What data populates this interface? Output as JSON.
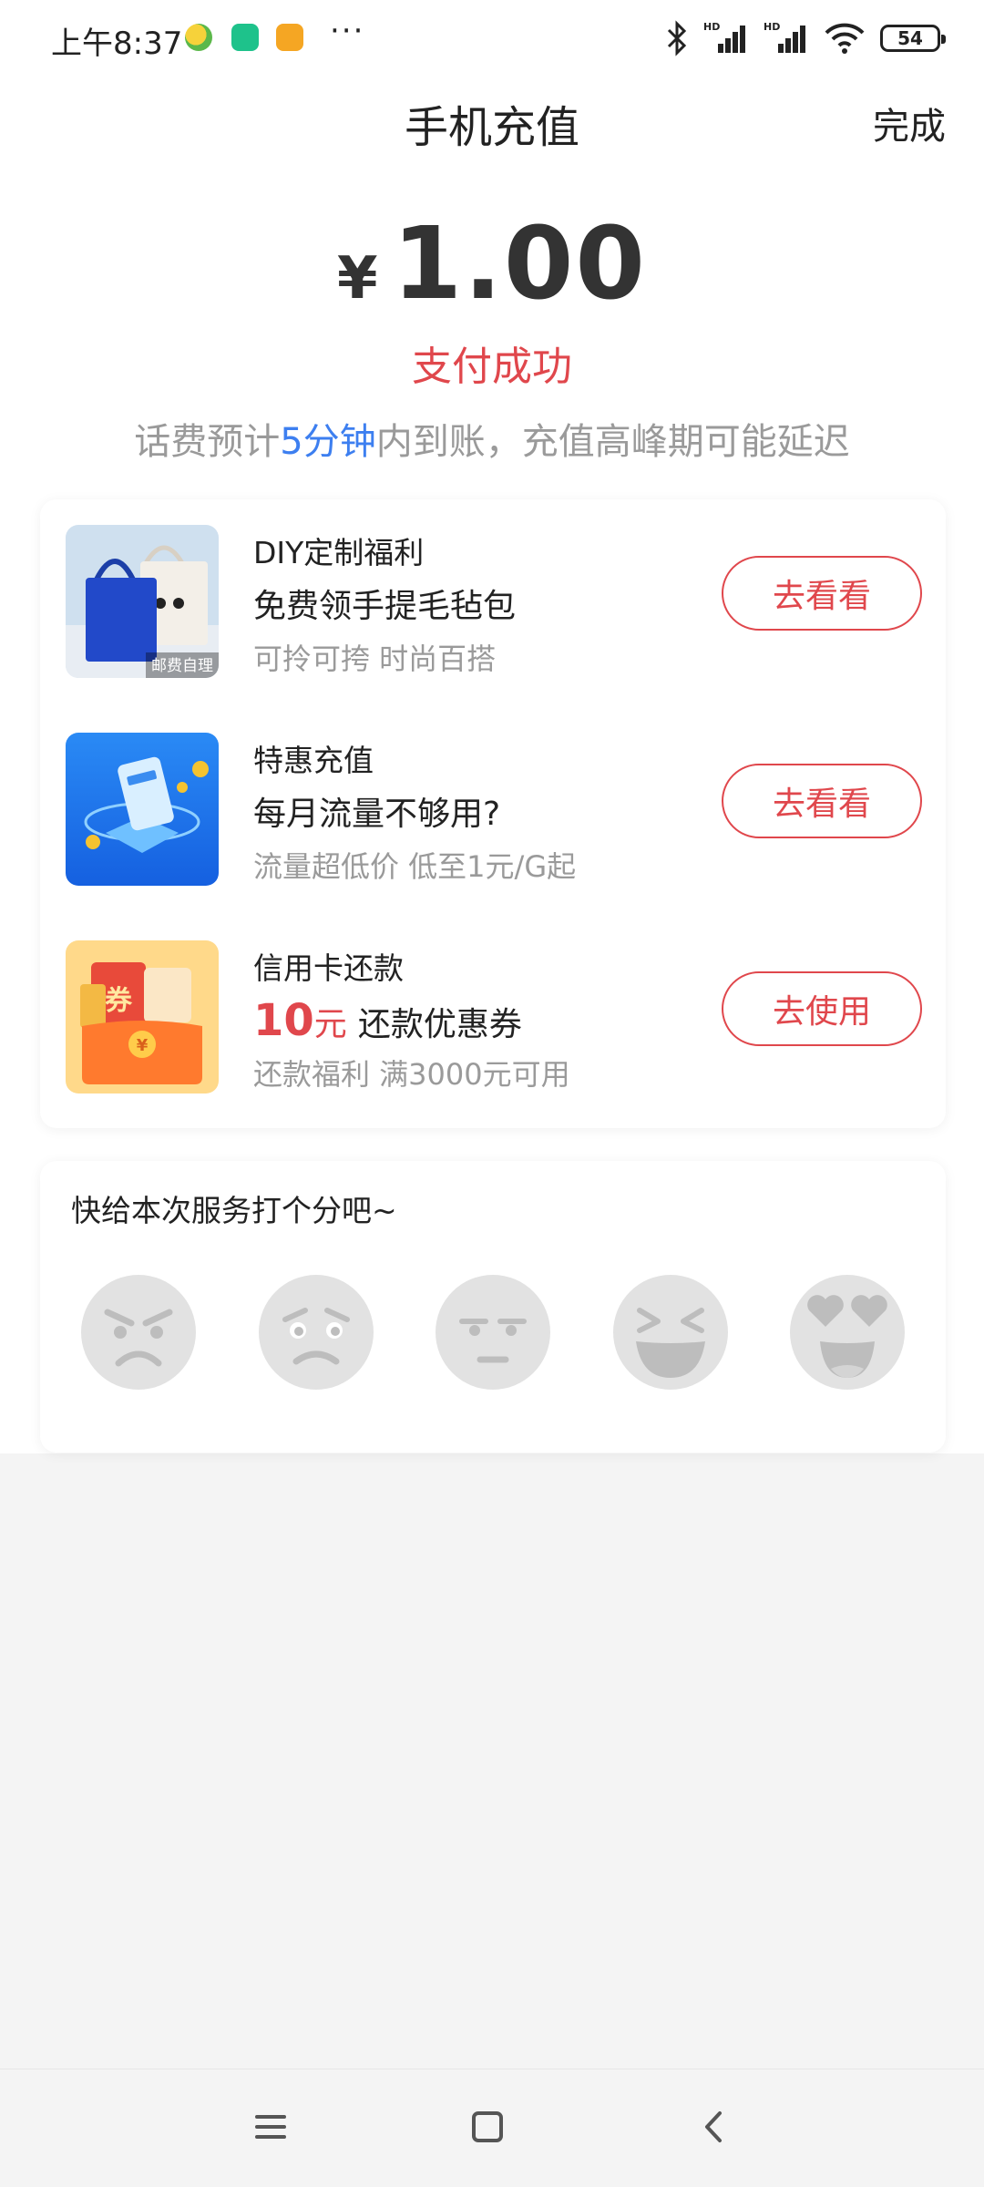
{
  "status_bar": {
    "time": "上午8:37",
    "more": "···",
    "battery": "54"
  },
  "header": {
    "title": "手机充值",
    "done_label": "完成"
  },
  "payment": {
    "currency": "¥",
    "amount": "1.00",
    "status": "支付成功",
    "notice_prefix": "话费预计",
    "notice_highlight": "5分钟",
    "notice_suffix": "内到账，充值高峰期可能延迟"
  },
  "offers": [
    {
      "category": "DIY定制福利",
      "title": "免费领手提毛毡包",
      "subtitle": "可拎可挎 时尚百搭",
      "button": "去看看",
      "thumb_badge": "邮费自理"
    },
    {
      "category": "特惠充值",
      "title": "每月流量不够用?",
      "subtitle": "流量超低价 低至1元/G起",
      "button": "去看看"
    },
    {
      "category": "信用卡还款",
      "amount": "10",
      "unit": "元",
      "title": "还款优惠券",
      "subtitle": "还款福利 满3000元可用",
      "button": "去使用",
      "thumb_badge": "券"
    }
  ],
  "rating": {
    "prompt": "快给本次服务打个分吧~",
    "faces": [
      "angry-face-icon",
      "sad-face-icon",
      "neutral-face-icon",
      "laughing-face-icon",
      "heart-eyes-face-icon"
    ]
  },
  "colors": {
    "accent_red": "#e0474c",
    "highlight_blue": "#3d7ff0",
    "muted_text": "#9a9a9a",
    "face_gray": "#e2e2e2"
  }
}
